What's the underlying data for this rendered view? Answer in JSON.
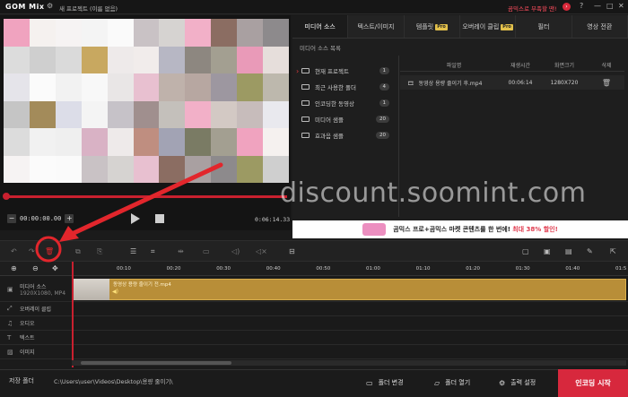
{
  "app": {
    "logo": "GOM Mix",
    "project_title": "새 프로젝트 (이름 없음)",
    "notice": "곰믹스로 부족할 땐!",
    "window_buttons": [
      "?",
      "—",
      "□",
      "✕"
    ]
  },
  "preview": {
    "current_time": "00:00:00.00",
    "duration": "0:06:14.33",
    "minus_label": "−",
    "plus_label": "+",
    "progress": 0.0
  },
  "tabs": [
    {
      "label": "미디어 소스",
      "pro": "",
      "active": true
    },
    {
      "label": "텍스트/이미지",
      "pro": "",
      "active": false
    },
    {
      "label": "템플릿",
      "pro": "Pro",
      "active": false
    },
    {
      "label": "오버레이 클립",
      "pro": "Pro",
      "active": false
    },
    {
      "label": "필터",
      "pro": "",
      "active": false
    },
    {
      "label": "영상 전환",
      "pro": "",
      "active": false
    }
  ],
  "media": {
    "section_title": "미디어 소스 목록",
    "folders": [
      {
        "label": "현재 프로젝트",
        "count": "1",
        "selected": true
      },
      {
        "label": "최근 사용한 폴더",
        "count": "4",
        "selected": false
      },
      {
        "label": "인코딩한 동영상",
        "count": "1",
        "selected": false
      },
      {
        "label": "미디어 샘플",
        "count": "20",
        "selected": false
      },
      {
        "label": "효과음 샘플",
        "count": "20",
        "selected": false
      }
    ],
    "table": {
      "headers": [
        "파일명",
        "재생시간",
        "화면크기",
        "삭제"
      ],
      "rows": [
        {
          "name": "동영상 용량 줄이기 후.mp4",
          "duration": "00:06:14",
          "size": "1280X720"
        }
      ]
    }
  },
  "promo": {
    "text": "곰믹스 프로+곰믹스 마켓 콘텐츠를 한 번에!",
    "highlight": "최대 38% 할인!"
  },
  "timeline": {
    "ticks": [
      "00:10",
      "00:20",
      "00:30",
      "00:40",
      "00:50",
      "01:00",
      "01:10",
      "01:20",
      "01:30",
      "01:40",
      "01:5"
    ],
    "tracks": [
      {
        "label": "미디어 소스",
        "sub": "1920X1080, MP4",
        "icon": "▣"
      },
      {
        "label": "오버레이 클립",
        "sub": "",
        "icon": "⤢"
      },
      {
        "label": "오디오",
        "sub": "",
        "icon": "♫"
      },
      {
        "label": "텍스트",
        "sub": "",
        "icon": "T"
      },
      {
        "label": "이미지",
        "sub": "",
        "icon": "▨"
      }
    ],
    "clip_name": "동영상 용량 줄이기 전.mp4",
    "clip_audio_icon": "◀)"
  },
  "footer": {
    "save_folder_label": "저장 폴더",
    "save_path": "C:\\Users\\user\\Videos\\Desktop\\용량 줄이기\\",
    "change_folder": "폴더 변경",
    "open_folder": "폴더 열기",
    "output_settings": "출력 설정",
    "encode": "인코딩 시작"
  },
  "watermark": "discount.soomint.com",
  "colors": {
    "accent": "#d7283d",
    "clip": "#b88e38",
    "annotation": "#e2262c"
  }
}
